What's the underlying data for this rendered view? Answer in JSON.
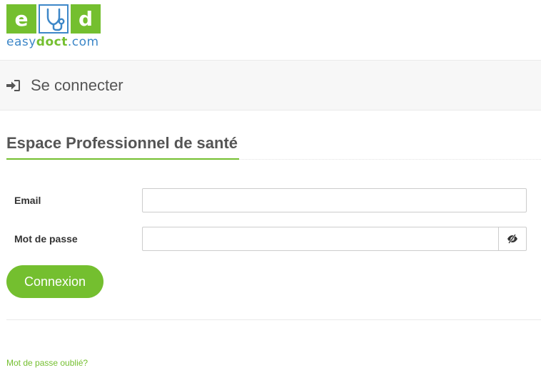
{
  "logo": {
    "tile_left": "e",
    "tile_right": "d",
    "text_easy": "easy",
    "text_doct": "doct",
    "text_com": ".com",
    "brand_green": "#74bf2f",
    "brand_blue": "#3d87c8"
  },
  "header": {
    "icon": "sign-in-icon",
    "title": "Se connecter"
  },
  "section": {
    "title": "Espace Professionnel de santé"
  },
  "form": {
    "email_label": "Email",
    "email_value": "",
    "password_label": "Mot de passe",
    "password_value": "",
    "toggle_icon": "eye-slash-icon",
    "submit_label": "Connexion"
  },
  "footer": {
    "forgot_password": "Mot de passe oublié?"
  }
}
